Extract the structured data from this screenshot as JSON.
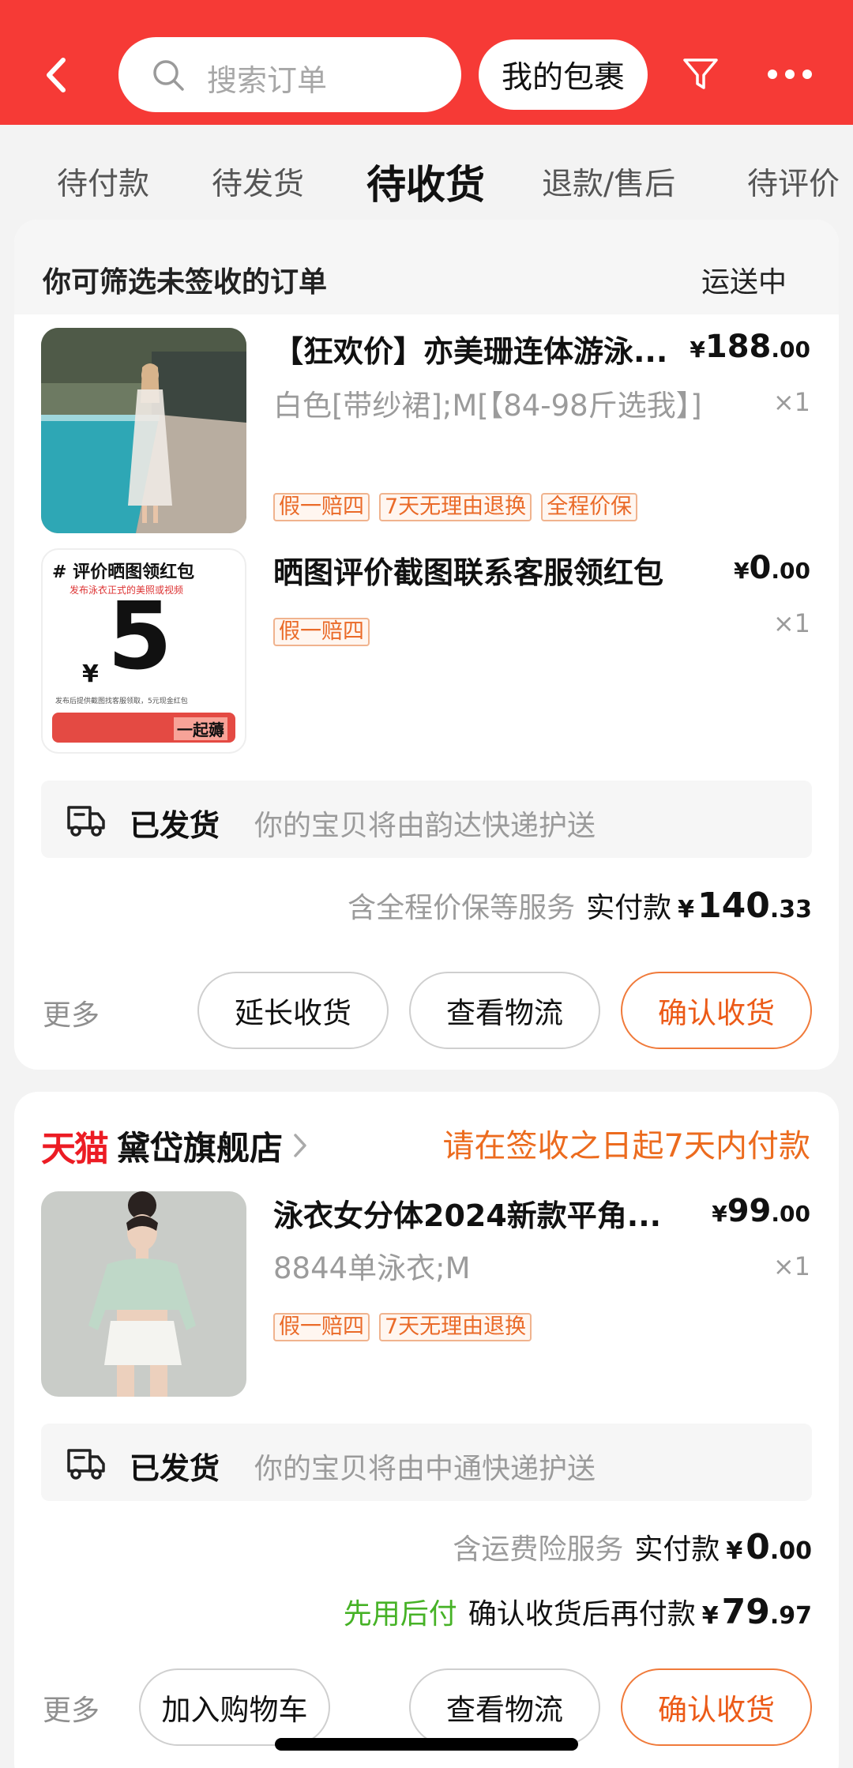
{
  "header": {
    "search_placeholder": "搜索订单",
    "parcel_label": "我的包裹",
    "accent": "#f63a36"
  },
  "tabs": [
    {
      "label": "待付款"
    },
    {
      "label": "待发货"
    },
    {
      "label": "待收货",
      "active": true
    },
    {
      "label": "退款/售后"
    },
    {
      "label": "待评价"
    }
  ],
  "order1": {
    "filter_hint": "你可筛选未签收的订单",
    "status": "运送中",
    "items": [
      {
        "title": "【狂欢价】亦美珊连体游泳...",
        "sku": "白色[带纱裙];M[【84-98斤选我】]",
        "price_currency": "¥",
        "price_int": "188",
        "price_dec": ".00",
        "qty": "×1",
        "tags": [
          "假一赔四",
          "7天无理由退换",
          "全程价保"
        ]
      },
      {
        "title": "晒图评价截图联系客服领红包",
        "price_currency": "¥",
        "price_int": "0",
        "price_dec": ".00",
        "qty": "×1",
        "tags": [
          "假一赔四"
        ],
        "thumb": {
          "headline": "# 评价晒图领红包",
          "sub": "发布泳衣正式的美照或视频",
          "amount": "5",
          "currency": "¥",
          "footer": "发布后提供截图找客服领取，5元现金红包",
          "cta": "一起薅"
        }
      }
    ],
    "shipping": {
      "status": "已发货",
      "desc": "你的宝贝将由韵达快递护送"
    },
    "payment": {
      "note": "含全程价保等服务",
      "label": "实付款",
      "currency": "¥",
      "int": "140",
      "dec": ".33"
    },
    "more": "更多",
    "actions": {
      "extend": "延长收货",
      "logistics": "查看物流",
      "confirm": "确认收货"
    }
  },
  "order2": {
    "tmall_logo": "天猫",
    "shop_name": "黛岱旗舰店",
    "pay_notice": "请在签收之日起7天内付款",
    "items": [
      {
        "title": "泳衣女分体2024新款平角...",
        "sku": "8844单泳衣;M",
        "price_currency": "¥",
        "price_int": "99",
        "price_dec": ".00",
        "qty": "×1",
        "tags": [
          "假一赔四",
          "7天无理由退换"
        ]
      }
    ],
    "shipping": {
      "status": "已发货",
      "desc": "你的宝贝将由中通快递护送"
    },
    "payment": {
      "note": "含运费险服务",
      "label": "实付款",
      "currency": "¥",
      "int": "0",
      "dec": ".00"
    },
    "later_pay": {
      "badge": "先用后付",
      "label": "确认收货后再付款",
      "currency": "¥",
      "int": "79",
      "dec": ".97"
    },
    "more": "更多",
    "actions": {
      "cart": "加入购物车",
      "logistics": "查看物流",
      "confirm": "确认收货"
    }
  }
}
